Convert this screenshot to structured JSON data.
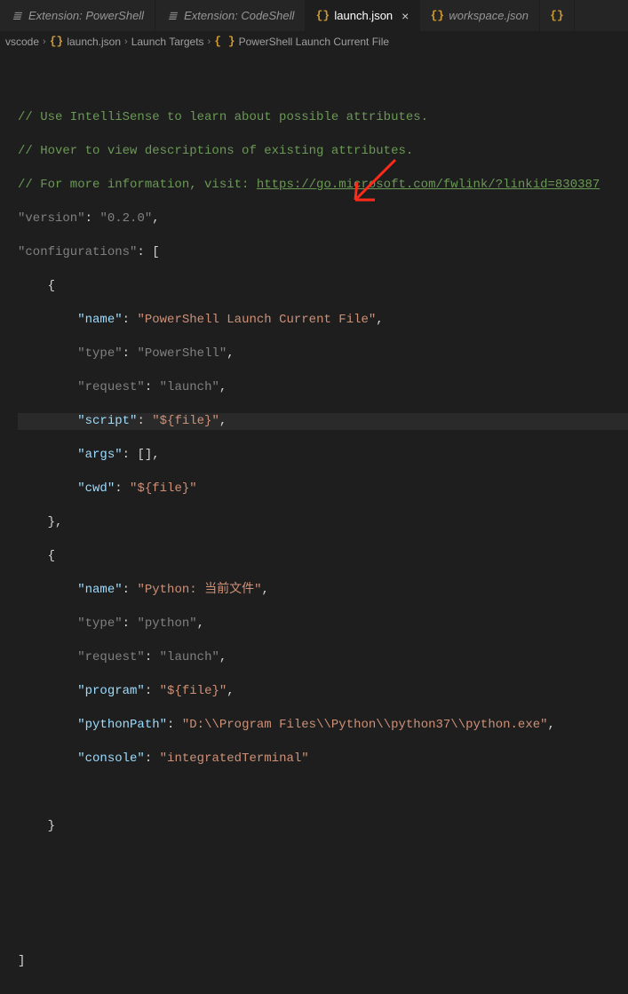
{
  "tabs": [
    {
      "label": "Extension: PowerShell",
      "icon": "≣",
      "active": false
    },
    {
      "label": "Extension: CodeShell",
      "icon": "≣",
      "active": false
    },
    {
      "label": "launch.json",
      "icon": "{}",
      "active": true
    },
    {
      "label": "workspace.json",
      "icon": "{}",
      "active": false
    },
    {
      "label": "",
      "icon": "{}",
      "active": false
    }
  ],
  "breadcrumb": {
    "root": "vscode",
    "file": "launch.json",
    "section": "Launch Targets",
    "item": "PowerShell Launch Current File"
  },
  "code": {
    "comment1": "// Use IntelliSense to learn about possible attributes.",
    "comment2": "// Hover to view descriptions of existing attributes.",
    "comment3_prefix": "// For more information, visit: ",
    "comment3_link": "https://go.microsoft.com/fwlink/?linkid=830387",
    "version_key": "\"version\"",
    "version_val": "\"0.2.0\"",
    "configs_key": "\"configurations\"",
    "cfg1": {
      "name_key": "\"name\"",
      "name_val": "\"PowerShell Launch Current File\"",
      "type_key": "\"type\"",
      "type_val": "\"PowerShell\"",
      "request_key": "\"request\"",
      "request_val": "\"launch\"",
      "script_key": "\"script\"",
      "script_val": "\"${file}\"",
      "args_key": "\"args\"",
      "args_val": "[]",
      "cwd_key": "\"cwd\"",
      "cwd_val": "\"${file}\""
    },
    "cfg2": {
      "name_key": "\"name\"",
      "name_val": "\"Python: 当前文件\"",
      "type_key": "\"type\"",
      "type_val": "\"python\"",
      "request_key": "\"request\"",
      "request_val": "\"launch\"",
      "program_key": "\"program\"",
      "program_val": "\"${file}\"",
      "pythonPath_key": "\"pythonPath\"",
      "pythonPath_val": "\"D:\\\\Program Files\\\\Python\\\\python37\\\\python.exe\"",
      "console_key": "\"console\"",
      "console_val": "\"integratedTerminal\""
    }
  },
  "punct": {
    "colon": ": ",
    "comma": ",",
    "lbrace": "{",
    "rbrace": "}",
    "lbracket": "[",
    "rbracket": "]"
  }
}
